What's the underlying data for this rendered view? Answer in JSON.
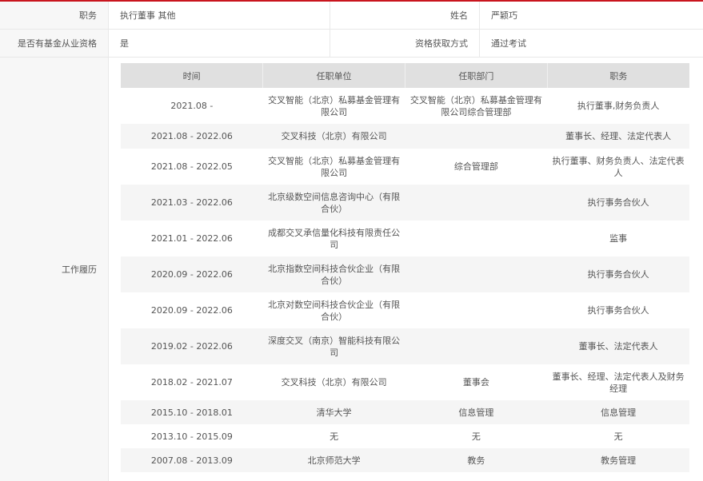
{
  "info": {
    "position_label": "职务",
    "position_value": "执行董事 其他",
    "name_label": "姓名",
    "name_value": "严颖巧",
    "qual_label": "是否有基金从业资格",
    "qual_value": "是",
    "method_label": "资格获取方式",
    "method_value": "通过考试",
    "work_label": "工作履历"
  },
  "table": {
    "headers": [
      "时间",
      "任职单位",
      "任职部门",
      "职务"
    ],
    "rows": [
      [
        "2021.08 -",
        "交叉智能（北京）私募基金管理有限公司",
        "交叉智能（北京）私募基金管理有限公司综合管理部",
        "执行董事,财务负责人"
      ],
      [
        "2021.08 - 2022.06",
        "交叉科技（北京）有限公司",
        "",
        "董事长、经理、法定代表人"
      ],
      [
        "2021.08 - 2022.05",
        "交叉智能（北京）私募基金管理有限公司",
        "综合管理部",
        "执行董事、财务负责人、法定代表人"
      ],
      [
        "2021.03 - 2022.06",
        "北京级数空间信息咨询中心（有限合伙）",
        "",
        "执行事务合伙人"
      ],
      [
        "2021.01 - 2022.06",
        "成都交叉承信量化科技有限责任公司",
        "",
        "监事"
      ],
      [
        "2020.09 - 2022.06",
        "北京指数空间科技合伙企业（有限合伙）",
        "",
        "执行事务合伙人"
      ],
      [
        "2020.09 - 2022.06",
        "北京对数空间科技合伙企业（有限合伙）",
        "",
        "执行事务合伙人"
      ],
      [
        "2019.02 - 2022.06",
        "深度交叉（南京）智能科技有限公司",
        "",
        "董事长、法定代表人"
      ],
      [
        "2018.02 - 2021.07",
        "交叉科技（北京）有限公司",
        "董事会",
        "董事长、经理、法定代表人及财务经理"
      ],
      [
        "2015.10 - 2018.01",
        "清华大学",
        "信息管理",
        "信息管理"
      ],
      [
        "2013.10 - 2015.09",
        "无",
        "无",
        "无"
      ],
      [
        "2007.08 - 2013.09",
        "北京师范大学",
        "教务",
        "教务管理"
      ]
    ]
  }
}
